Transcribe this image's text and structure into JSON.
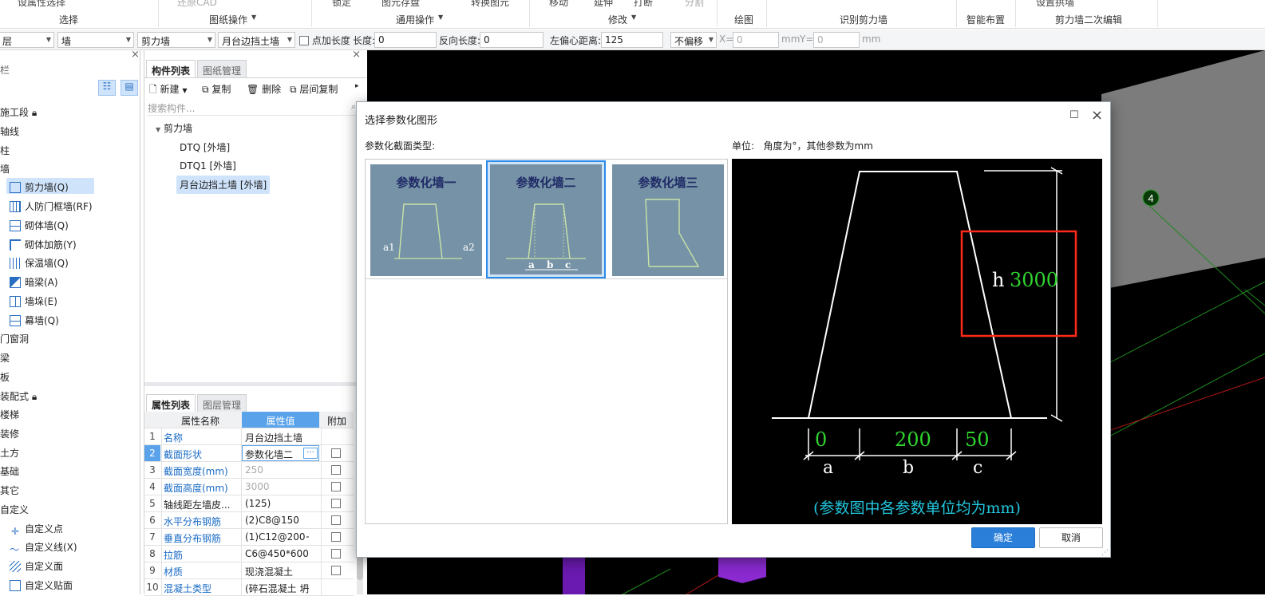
{
  "ribbon": {
    "top_items": [
      "设属性选择",
      "还原CAD",
      "锁定",
      "图元存盘",
      "转换图元",
      "移动",
      "延伸",
      "打断",
      "分割",
      "设置拱墙"
    ],
    "groups": [
      "选择",
      "图纸操作",
      "通用操作",
      "修改",
      "绘图",
      "识别剪力墙",
      "智能布置",
      "剪力墙二次编辑"
    ]
  },
  "filter_bar": {
    "floor": "层",
    "category": "墙",
    "type": "剪力墙",
    "component": "月台边挡土墙",
    "add_length_label": "点加长度",
    "length_label": "长度:",
    "length_value": "0",
    "reverse_length_label": "反向长度:",
    "reverse_length_value": "0",
    "left_offset_label": "左偏心距离:",
    "left_offset_value": "125",
    "offset_mode": "不偏移",
    "x_label": "X=",
    "x_value": "0",
    "mm1": "mm",
    "y_label": "Y=",
    "y_value": "0",
    "mm2": "mm"
  },
  "nav": {
    "title": "栏",
    "items": [
      {
        "label": "施工段"
      },
      {
        "label": "轴线"
      },
      {
        "label": "柱"
      },
      {
        "label": "墙"
      },
      {
        "label": "剪力墙(Q)",
        "selected": true
      },
      {
        "label": "人防门框墙(RF)"
      },
      {
        "label": "砌体墙(Q)"
      },
      {
        "label": "砌体加筋(Y)"
      },
      {
        "label": "保温墙(Q)"
      },
      {
        "label": "暗梁(A)"
      },
      {
        "label": "墙垛(E)"
      },
      {
        "label": "幕墙(Q)"
      },
      {
        "label": "门窗洞"
      },
      {
        "label": "梁"
      },
      {
        "label": "板"
      },
      {
        "label": "装配式"
      },
      {
        "label": "楼梯"
      },
      {
        "label": "装修"
      },
      {
        "label": "土方"
      },
      {
        "label": "基础"
      },
      {
        "label": "其它"
      },
      {
        "label": "自定义"
      },
      {
        "label": "自定义点"
      },
      {
        "label": "自定义线(X)"
      },
      {
        "label": "自定义面"
      },
      {
        "label": "自定义贴面"
      }
    ]
  },
  "component_panel": {
    "tabs": [
      "构件列表",
      "图纸管理"
    ],
    "toolbar": {
      "new": "新建",
      "copy": "复制",
      "delete": "删除",
      "floor_copy": "层间复制"
    },
    "search_placeholder": "搜索构件...",
    "tree_root": "剪力墙",
    "tree_items": [
      "DTQ [外墙]",
      "DTQ1 [外墙]",
      "月台边挡土墙 [外墙]"
    ]
  },
  "property_panel": {
    "tabs": [
      "属性列表",
      "图层管理"
    ],
    "headers": [
      "属性名称",
      "属性值",
      "附加"
    ],
    "rows": [
      {
        "no": "1",
        "name": "名称",
        "value": "月台边挡土墙",
        "name_blue": true,
        "value_gray": false,
        "has_check": false
      },
      {
        "no": "2",
        "name": "截面形状",
        "value": "参数化墙二",
        "name_blue": true,
        "value_gray": false,
        "has_check": true
      },
      {
        "no": "3",
        "name": "截面宽度(mm)",
        "value": "250",
        "name_blue": true,
        "value_gray": true,
        "has_check": true
      },
      {
        "no": "4",
        "name": "截面高度(mm)",
        "value": "3000",
        "name_blue": true,
        "value_gray": true,
        "has_check": true
      },
      {
        "no": "5",
        "name": "轴线距左墙皮...",
        "value": "(125)",
        "name_blue": false,
        "value_gray": false,
        "has_check": true
      },
      {
        "no": "6",
        "name": "水平分布钢筋",
        "value": "(2)C8@150",
        "name_blue": true,
        "value_gray": false,
        "has_check": true
      },
      {
        "no": "7",
        "name": "垂直分布钢筋",
        "value": "(1)C12@200+...",
        "name_blue": true,
        "value_gray": false,
        "has_check": true
      },
      {
        "no": "8",
        "name": "拉筋",
        "value": "C6@450*600",
        "name_blue": true,
        "value_gray": false,
        "has_check": true
      },
      {
        "no": "9",
        "name": "材质",
        "value": "现浇混凝土",
        "name_blue": true,
        "value_gray": false,
        "has_check": true
      },
      {
        "no": "10",
        "name": "混凝土类型",
        "value": "(碎石混凝土 坍",
        "name_blue": true,
        "value_gray": false,
        "has_check": false
      }
    ]
  },
  "viewport": {
    "axis_label": "4"
  },
  "dialog": {
    "title": "选择参数化图形",
    "section_label": "参数化截面类型:",
    "unit_label": "单位:",
    "unit_desc": "角度为°，其他参数为mm",
    "shapes": [
      {
        "title": "参数化墙一",
        "left_label": "a1",
        "right_label": "a2"
      },
      {
        "title": "参数化墙二",
        "labels": [
          "a",
          "b",
          "c"
        ]
      },
      {
        "title": "参数化墙三"
      }
    ],
    "preview": {
      "h_label": "h",
      "h_value": "3000",
      "a_value": "0",
      "b_value": "200",
      "c_value": "50",
      "a_label": "a",
      "b_label": "b",
      "c_label": "c",
      "note": "(参数图中各参数单位均为mm)"
    },
    "ok": "确定",
    "cancel": "取消"
  }
}
